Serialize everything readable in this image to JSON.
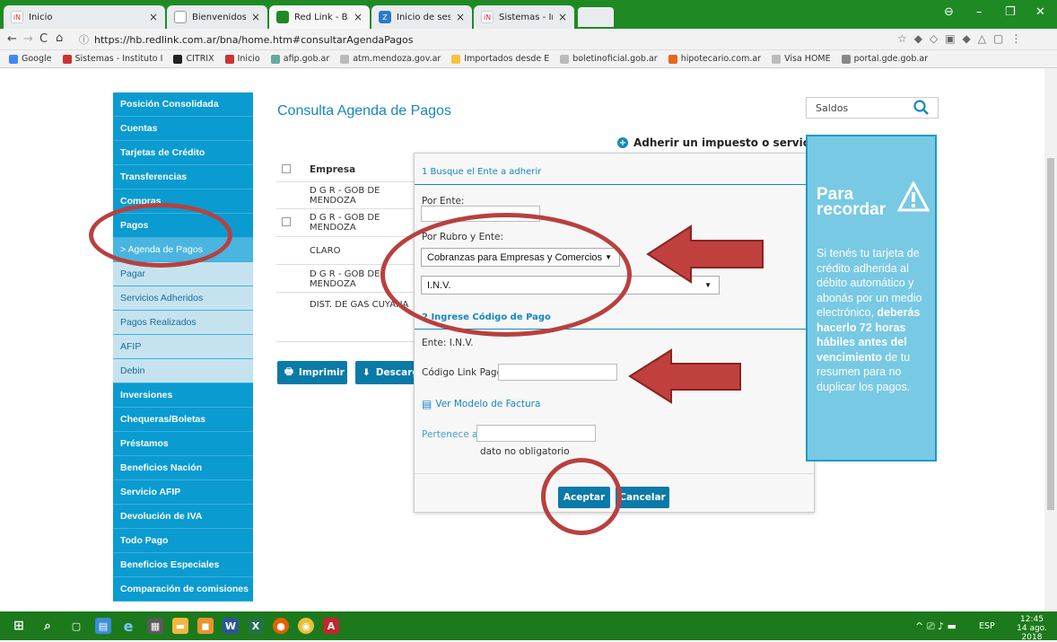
{
  "browser": {
    "tabs": [
      {
        "label": "Inicio",
        "fav_color": "#ffffff",
        "fav_text": "iN",
        "active": false
      },
      {
        "label": "Bienvenidos a LinkPagos",
        "fav_color": "#ffffff",
        "fav_text": "",
        "active": false
      },
      {
        "label": "Red Link - BANCO DE LA",
        "fav_color": "#1f8a24",
        "fav_text": "",
        "active": true
      },
      {
        "label": "Inicio de sesión en el clie",
        "fav_color": "#2b79c7",
        "fav_text": "Z",
        "active": false
      },
      {
        "label": "Sistemas - Instituto Nacio",
        "fav_color": "#ffffff",
        "fav_text": "iN",
        "active": false
      }
    ],
    "url": "https://hb.redlink.com.ar/bna/home.htm#consultarAgendaPagos",
    "bookmarks": [
      "Google",
      "Sistemas - Instituto I",
      "CITRIX",
      "Inicio",
      "afip.gob.ar",
      "atm.mendoza.gov.ar",
      "Importados desde E",
      "boletinoficial.gob.ar",
      "hipotecario.com.ar",
      "Visa HOME",
      "portal.gde.gob.ar"
    ]
  },
  "sidebar": {
    "items": [
      {
        "label": "Posición Consolidada",
        "type": "main"
      },
      {
        "label": "Cuentas",
        "type": "main"
      },
      {
        "label": "Tarjetas de Crédito",
        "type": "main"
      },
      {
        "label": "Transferencias",
        "type": "main"
      },
      {
        "label": "Compras",
        "type": "main"
      },
      {
        "label": "Pagos",
        "type": "main"
      },
      {
        "label": "> Agenda de Pagos",
        "type": "subactive"
      },
      {
        "label": "Pagar",
        "type": "sub"
      },
      {
        "label": "Servicios Adheridos",
        "type": "sub"
      },
      {
        "label": "Pagos Realizados",
        "type": "sub"
      },
      {
        "label": "AFIP",
        "type": "sub"
      },
      {
        "label": "Debin",
        "type": "sub"
      },
      {
        "label": "Inversiones",
        "type": "main"
      },
      {
        "label": "Chequeras/Boletas",
        "type": "main"
      },
      {
        "label": "Préstamos",
        "type": "main"
      },
      {
        "label": "Beneficios Nación",
        "type": "main"
      },
      {
        "label": "Servicio AFIP",
        "type": "main"
      },
      {
        "label": "Devolución de IVA",
        "type": "main"
      },
      {
        "label": "Todo Pago",
        "type": "main"
      },
      {
        "label": "Beneficios Especiales",
        "type": "main"
      },
      {
        "label": "Comparación de comisiones",
        "type": "main"
      }
    ]
  },
  "main": {
    "title": "Consulta Agenda de Pagos",
    "search_value": "Saldos",
    "adherir": "Adherir un impuesto o servicio",
    "column_empresa": "Empresa",
    "rows": [
      "D G R - GOB DE MENDOZA",
      "D G R - GOB DE MENDOZA",
      "CLARO",
      "D G R - GOB DE MENDOZA",
      "DIST. DE GAS CUYANA"
    ],
    "imprimir": "Imprimir",
    "descargar": "Descarg"
  },
  "modal": {
    "step1": "1 Busque el Ente a adherir",
    "por_ente": "Por Ente:",
    "por_rubro": "Por Rubro y Ente:",
    "rubro_value": "Cobranzas para Empresas y Comercios",
    "ente_value": "I.N.V.",
    "step2": "2 Ingrese Código de Pago",
    "ente_label": "Ente: I.N.V.",
    "codigo_label": "Código Link Pagos",
    "ver_modelo": "Ver Modelo de Factura",
    "pertenece": "Pertenece a:",
    "no_oblig": "dato no obligatorio",
    "aceptar": "Aceptar",
    "cancelar": "Cancelar"
  },
  "info": {
    "title1": "Para",
    "title2": "recordar",
    "text_a": "Si tenés tu tarjeta de crédito adherida al débito automático y abonás por un medio electrónico,",
    "text_b": "deberás hacerlo 72 horas hábiles antes del vencimiento",
    "text_c": "de tu resumen para no duplicar los pagos."
  },
  "taskbar": {
    "lang": "ESP",
    "time": "12:45",
    "date": "14 ago. 2018"
  },
  "colors": {
    "accent": "#0a9bd1",
    "sidebar_sub": "#c5e3ef",
    "annotation": "#b8403f",
    "browser_green": "#1f8a24"
  }
}
